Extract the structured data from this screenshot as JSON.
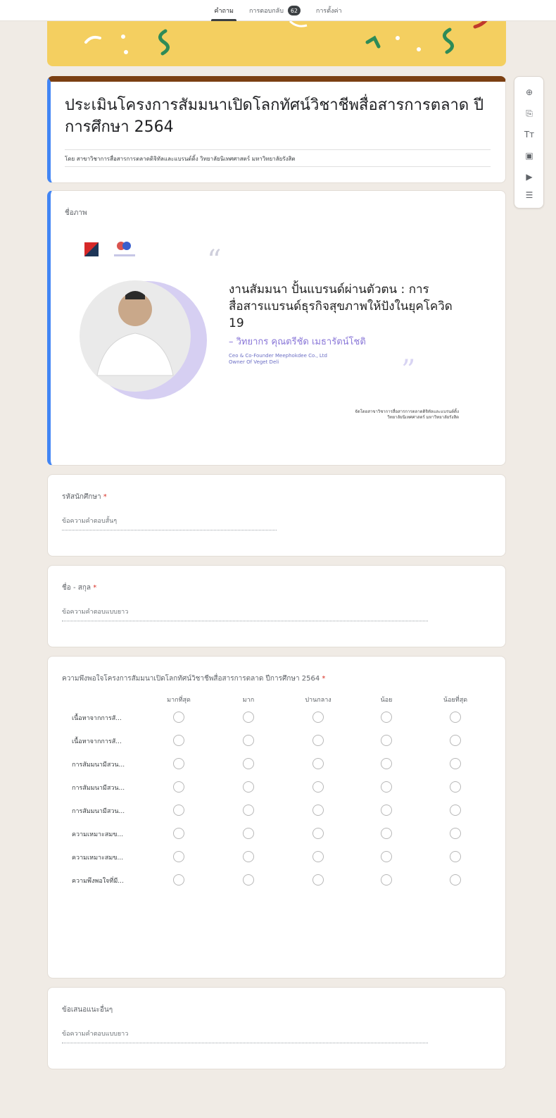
{
  "tabs": [
    {
      "label": "คำถาม",
      "active": true
    },
    {
      "label": "การตอบกลับ",
      "badge": "62"
    },
    {
      "label": "การตั้งค่า"
    }
  ],
  "form": {
    "title": "ประเมินโครงการสัมมนาเปิดโลกทัศน์วิชาชีพสื่อสารการตลาด ปีการศึกษา 2564",
    "description": "โดย สาขาวิชาการสื่อสารการตลาดดิจิทัลและแบรนด์ดิ้ง วิทยาลัยนิเทศศาสตร์ มหาวิทยาลัยรังสิต"
  },
  "image_section": {
    "label": "ชื่อภาพ",
    "poster": {
      "headline": "งานสัมมนา ปั้นแบรนด์ผ่านตัวตน : การสื่อสารแบรนด์ธุรกิจสุขภาพให้ปังในยุคโควิด 19",
      "speaker": "– วิทยากร คุณตรีชัด เมธารัตน์โชติ",
      "role_line1": "Ceo & Co-Founder Meephokdee Co., Ltd",
      "role_line2": "Owner Of Veget Deli",
      "footer_line1": "จัดโดยสาขาวิชาการสื่อสารการตลาดดิจิทัลและแบรนด์ดิ้ง",
      "footer_line2": "วิทยาลัยนิเทศศาสตร์ มหาวิทยาลัยรังสิต"
    }
  },
  "questions": {
    "student_id": {
      "label": "รหัสนักศึกษา",
      "required": "*",
      "hint": "ข้อความคำตอบสั้นๆ"
    },
    "full_name": {
      "label": "ชื่อ - สกุล",
      "required": "*",
      "hint": "ข้อความคำตอบแบบยาว"
    },
    "satisfaction": {
      "label": "ความพึงพอใจโครงการสัมมนาเปิดโลกทัศน์วิชาชีพสื่อสารการตลาด ปีการศึกษา 2564",
      "required": "*",
      "columns": [
        "มากที่สุด",
        "มาก",
        "ปานกลาง",
        "น้อย",
        "น้อยที่สุด"
      ],
      "rows": [
        "เนื้อหาจากการสั...",
        "เนื้อหาจากการสั...",
        "การสัมมนามีสวน...",
        "การสัมมนามีสวน...",
        "การสัมมนามีสวน...",
        "ความเหมาะสมข...",
        "ความเหมาะสมข...",
        "ความพึงพอใจที่มี..."
      ]
    },
    "suggestions": {
      "label": "ข้อเสนอแนะอื่นๆ",
      "hint": "ข้อความคำตอบแบบยาว"
    }
  },
  "toolbar": [
    {
      "icon": "add-question-icon",
      "glyph": "⊕"
    },
    {
      "icon": "import-questions-icon",
      "glyph": "⎘"
    },
    {
      "icon": "add-title-icon",
      "glyph": "Tт"
    },
    {
      "icon": "add-image-icon",
      "glyph": "▣"
    },
    {
      "icon": "add-video-icon",
      "glyph": "▶"
    },
    {
      "icon": "add-section-icon",
      "glyph": "☰"
    }
  ],
  "colors": {
    "banner": "#f4cf60",
    "theme_top": "#7b3f12",
    "accent": "#4285f4",
    "background": "#f0ebe5"
  }
}
